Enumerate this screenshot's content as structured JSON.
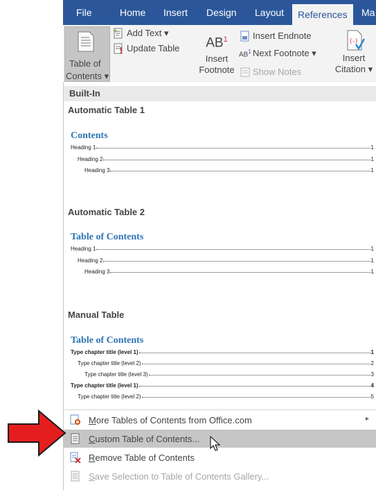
{
  "tabs": [
    "File",
    "Home",
    "Insert",
    "Design",
    "Layout",
    "References",
    "Ma"
  ],
  "ribbon": {
    "toc_line1": "Table of",
    "toc_line2": "Contents ▾",
    "add_text": "Add Text ▾",
    "update_table": "Update Table",
    "insert_footnote_1": "Insert",
    "insert_footnote_2": "Footnote",
    "ab_symbol": "AB",
    "ab_super": "1",
    "insert_endnote": "Insert Endnote",
    "next_footnote": "Next Footnote ▾",
    "show_notes": "Show Notes",
    "insert_citation_1": "Insert",
    "insert_citation_2": "Citation ▾"
  },
  "gallery": {
    "builtin_label": "Built-In",
    "auto1": {
      "title": "Automatic Table 1",
      "heading": "Contents",
      "entries": [
        {
          "text": "Heading 1",
          "page": "1"
        },
        {
          "text": "Heading 2",
          "page": "1"
        },
        {
          "text": "Heading 3",
          "page": "1"
        }
      ]
    },
    "auto2": {
      "title": "Automatic Table 2",
      "heading": "Table of Contents",
      "entries": [
        {
          "text": "Heading 1",
          "page": "1"
        },
        {
          "text": "Heading 2",
          "page": "1"
        },
        {
          "text": "Heading 3",
          "page": "1"
        }
      ]
    },
    "manual": {
      "title": "Manual Table",
      "heading": "Table of Contents",
      "entries": [
        {
          "text": "Type chapter title (level 1)",
          "page": "1"
        },
        {
          "text": "Type chapter title (level 2)",
          "page": "2"
        },
        {
          "text": "Type chapter title (level 3)",
          "page": "3"
        },
        {
          "text": "Type chapter title (level 1)",
          "page": "4"
        },
        {
          "text": "Type chapter title (level 2)",
          "page": "5"
        }
      ]
    }
  },
  "menu": {
    "more_tables_prefix": "M",
    "more_tables_rest": "ore Tables of Contents from Office.com",
    "custom_prefix": "C",
    "custom_rest": "ustom Table of Contents...",
    "remove_prefix": "R",
    "remove_rest": "emove Table of Contents",
    "save_prefix": "S",
    "save_rest": "ave Selection to Table of Contents Gallery...",
    "arrow": "▸"
  },
  "colors": {
    "tab_bar": "#2b579a",
    "highlight": "#c6c6c6",
    "heading_blue": "#2e74b5",
    "red_arrow": "#e41e1e"
  }
}
